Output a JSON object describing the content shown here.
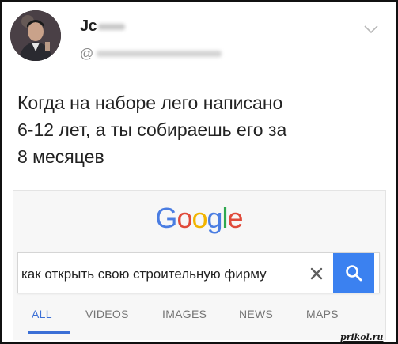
{
  "author": {
    "name": "Jс",
    "handle": "@"
  },
  "tweet": {
    "lines": [
      "Когда на наборе лего написано",
      "6-12 лет, а ты собираешь его за",
      "8 месяцев"
    ]
  },
  "google": {
    "logo_letters": [
      {
        "char": "G",
        "color": "#4a7de2"
      },
      {
        "char": "o",
        "color": "#e04a3a"
      },
      {
        "char": "o",
        "color": "#f2b400"
      },
      {
        "char": "g",
        "color": "#4a7de2"
      },
      {
        "char": "l",
        "color": "#2ea84f"
      },
      {
        "char": "e",
        "color": "#e04a3a"
      }
    ],
    "search": {
      "value": "как открыть свою строительную фирму",
      "clear_icon": "close-icon",
      "button_icon": "search-icon",
      "button_color": "#3b81f0"
    },
    "tabs": [
      "ALL",
      "VIDEOS",
      "IMAGES",
      "NEWS",
      "MAPS"
    ],
    "active_tab": "ALL",
    "accent_color": "#3b6fd6"
  },
  "watermark": "prikol.ru"
}
